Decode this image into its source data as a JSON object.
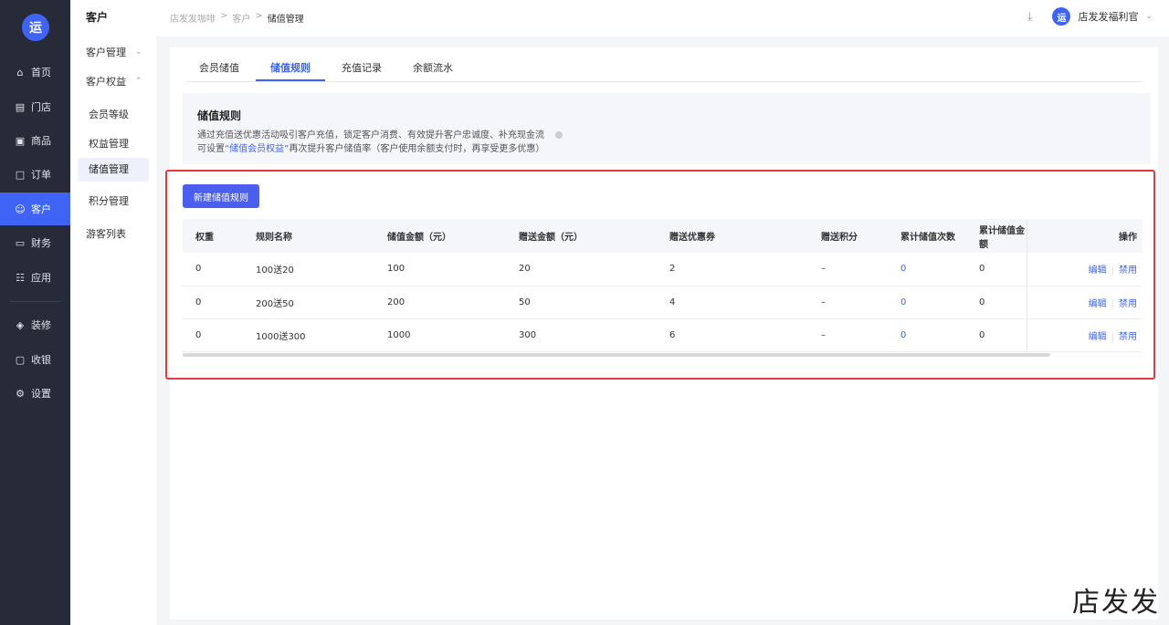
{
  "nav": {
    "logo": "运",
    "items": [
      {
        "icon": "home-icon",
        "glyph": "⌂",
        "label": "首页"
      },
      {
        "icon": "store-icon",
        "glyph": "▤",
        "label": "门店"
      },
      {
        "icon": "goods-icon",
        "glyph": "▣",
        "label": "商品"
      },
      {
        "icon": "order-icon",
        "glyph": "□",
        "label": "订单"
      },
      {
        "icon": "customer-icon",
        "glyph": "☺",
        "label": "客户"
      },
      {
        "icon": "finance-icon",
        "glyph": "▭",
        "label": "财务"
      },
      {
        "icon": "apps-icon",
        "glyph": "☷",
        "label": "应用"
      },
      {
        "icon": "decorate-icon",
        "glyph": "◈",
        "label": "装修"
      },
      {
        "icon": "cashier-icon",
        "glyph": "▢",
        "label": "收银"
      },
      {
        "icon": "settings-icon",
        "glyph": "⚙",
        "label": "设置"
      }
    ]
  },
  "submenu": {
    "title": "客户",
    "group_manage": "客户管理",
    "group_rights": "客户权益",
    "items": [
      "会员等级",
      "权益管理",
      "储值管理",
      "积分管理"
    ],
    "visitor_list": "游客列表"
  },
  "header": {
    "breadcrumb": [
      "店发发咖啡",
      "客户",
      "储值管理"
    ],
    "store_name": "店发发福利官"
  },
  "tabs": [
    "会员储值",
    "储值规则",
    "充值记录",
    "余额流水"
  ],
  "info": {
    "title": "储值规则",
    "line1": "通过充值送优惠活动吸引客户充值，锁定客户消费、有效提升客户忠诚度、补充现金流",
    "line2_pre": "可设置",
    "line2_link": "“储值会员权益”",
    "line2_post": "再次提升客户储值率（客户使用余额支付时，再享受更多优惠）"
  },
  "new_button": "新建储值规则",
  "table": {
    "headers": [
      "权重",
      "规则名称",
      "储值金额（元）",
      "赠送金额（元）",
      "赠送优惠券",
      "赠送积分",
      "累计储值次数",
      "累计储值金额",
      "操作"
    ],
    "rows": [
      [
        "0",
        "100送20",
        "100",
        "20",
        "2",
        "–",
        "0",
        "0"
      ],
      [
        "0",
        "200送50",
        "200",
        "50",
        "4",
        "–",
        "0",
        "0"
      ],
      [
        "0",
        "1000送300",
        "1000",
        "300",
        "6",
        "–",
        "0",
        "0"
      ]
    ],
    "edit": "编辑",
    "disable": "禁用"
  },
  "watermark": "店发发"
}
